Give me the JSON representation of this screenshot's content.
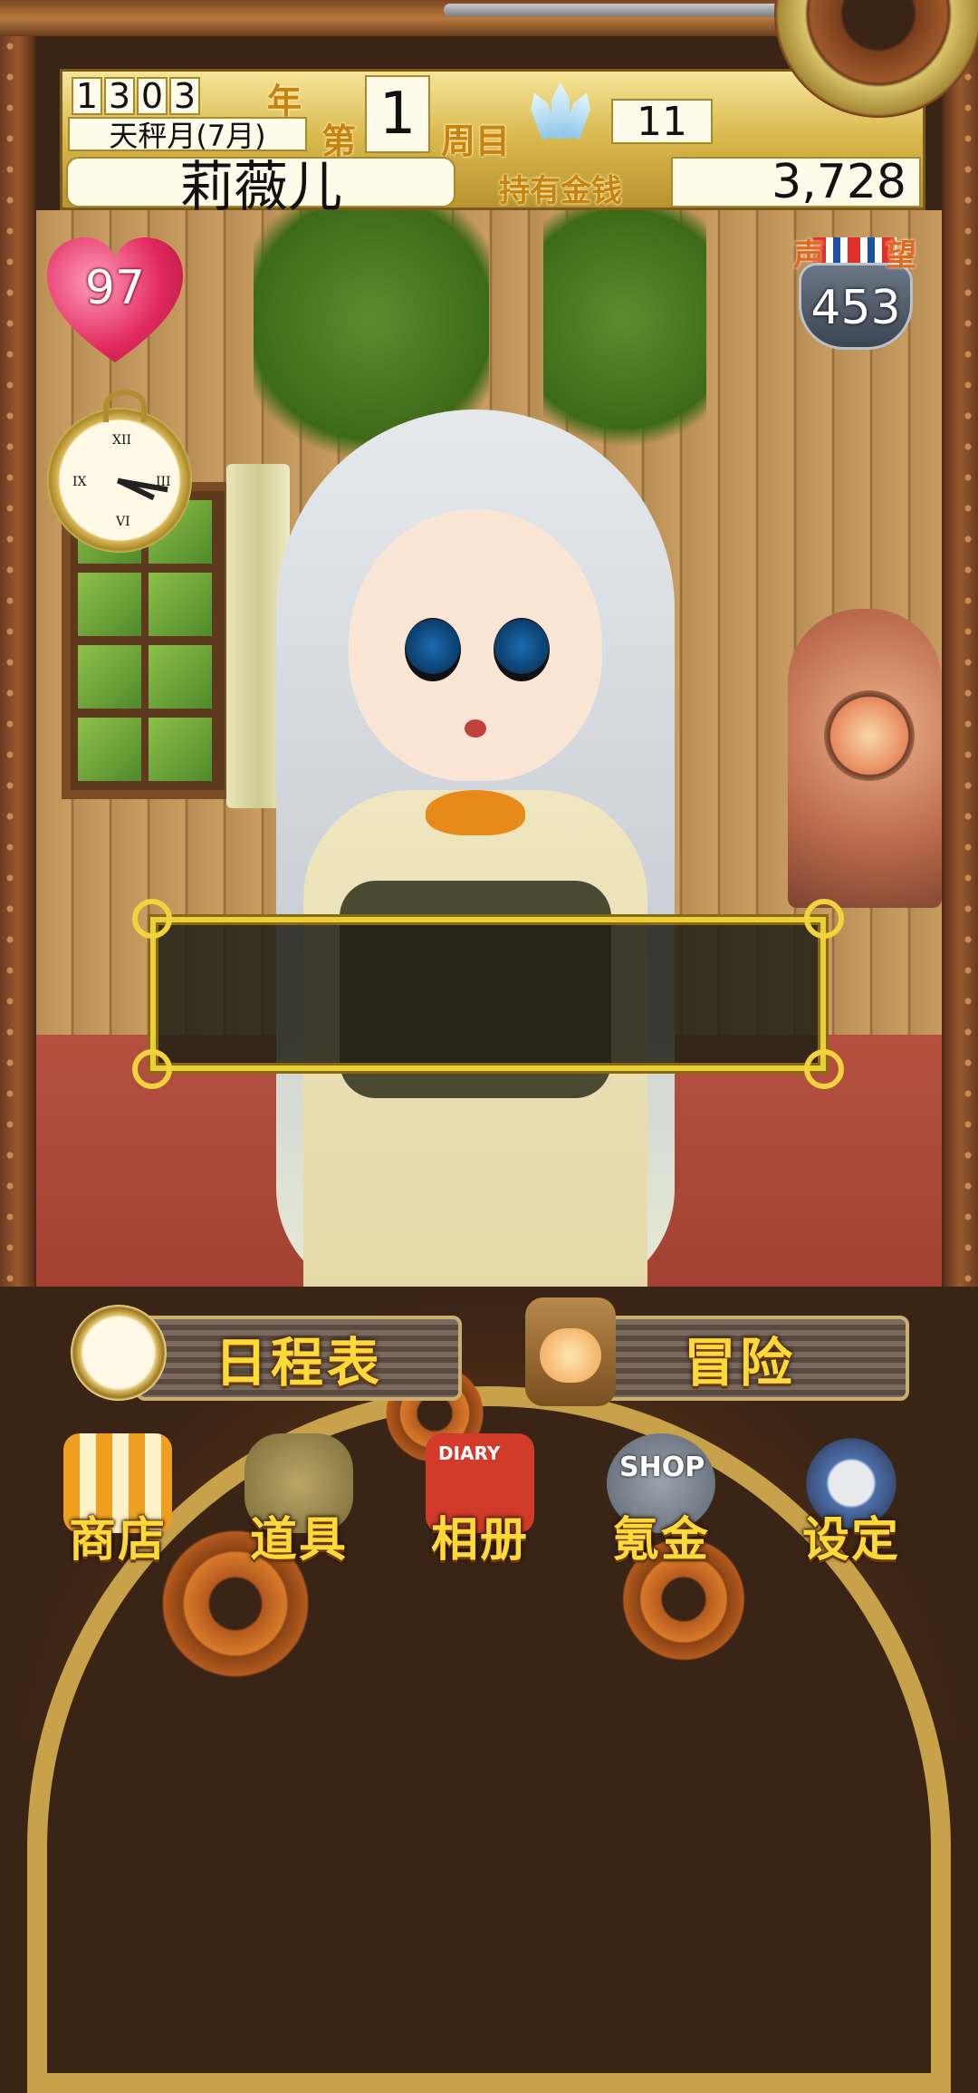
{
  "header": {
    "year_digits": [
      "1",
      "3",
      "0",
      "3"
    ],
    "year_suffix": "年",
    "month": "天秤月(7月)",
    "week_prefix": "第",
    "week": "1",
    "week_suffix": "周目",
    "gems": "11",
    "character_name": "莉薇儿",
    "money_label": "持有金钱",
    "money": "3,728"
  },
  "status": {
    "affection": "97",
    "fame_label_left": "声",
    "fame_label_right": "望",
    "fame": "453"
  },
  "dialog": {
    "text": ""
  },
  "actions": {
    "schedule": "日程表",
    "adventure": "冒险"
  },
  "menu": [
    {
      "label": "商店",
      "icon": "shop-icon"
    },
    {
      "label": "道具",
      "icon": "bag-icon"
    },
    {
      "label": "相册",
      "icon": "diary-icon"
    },
    {
      "label": "氪金",
      "icon": "premium-shop-icon"
    },
    {
      "label": "设定",
      "icon": "settings-icon"
    }
  ],
  "menu_art_text": {
    "diary": "DIARY",
    "shop": "SHOP"
  },
  "colors": {
    "gold_text": "#ffd83a",
    "header_gold": "#d8b74c",
    "heart": "#e22a5e",
    "dialog_border": "#e9cf3a"
  }
}
